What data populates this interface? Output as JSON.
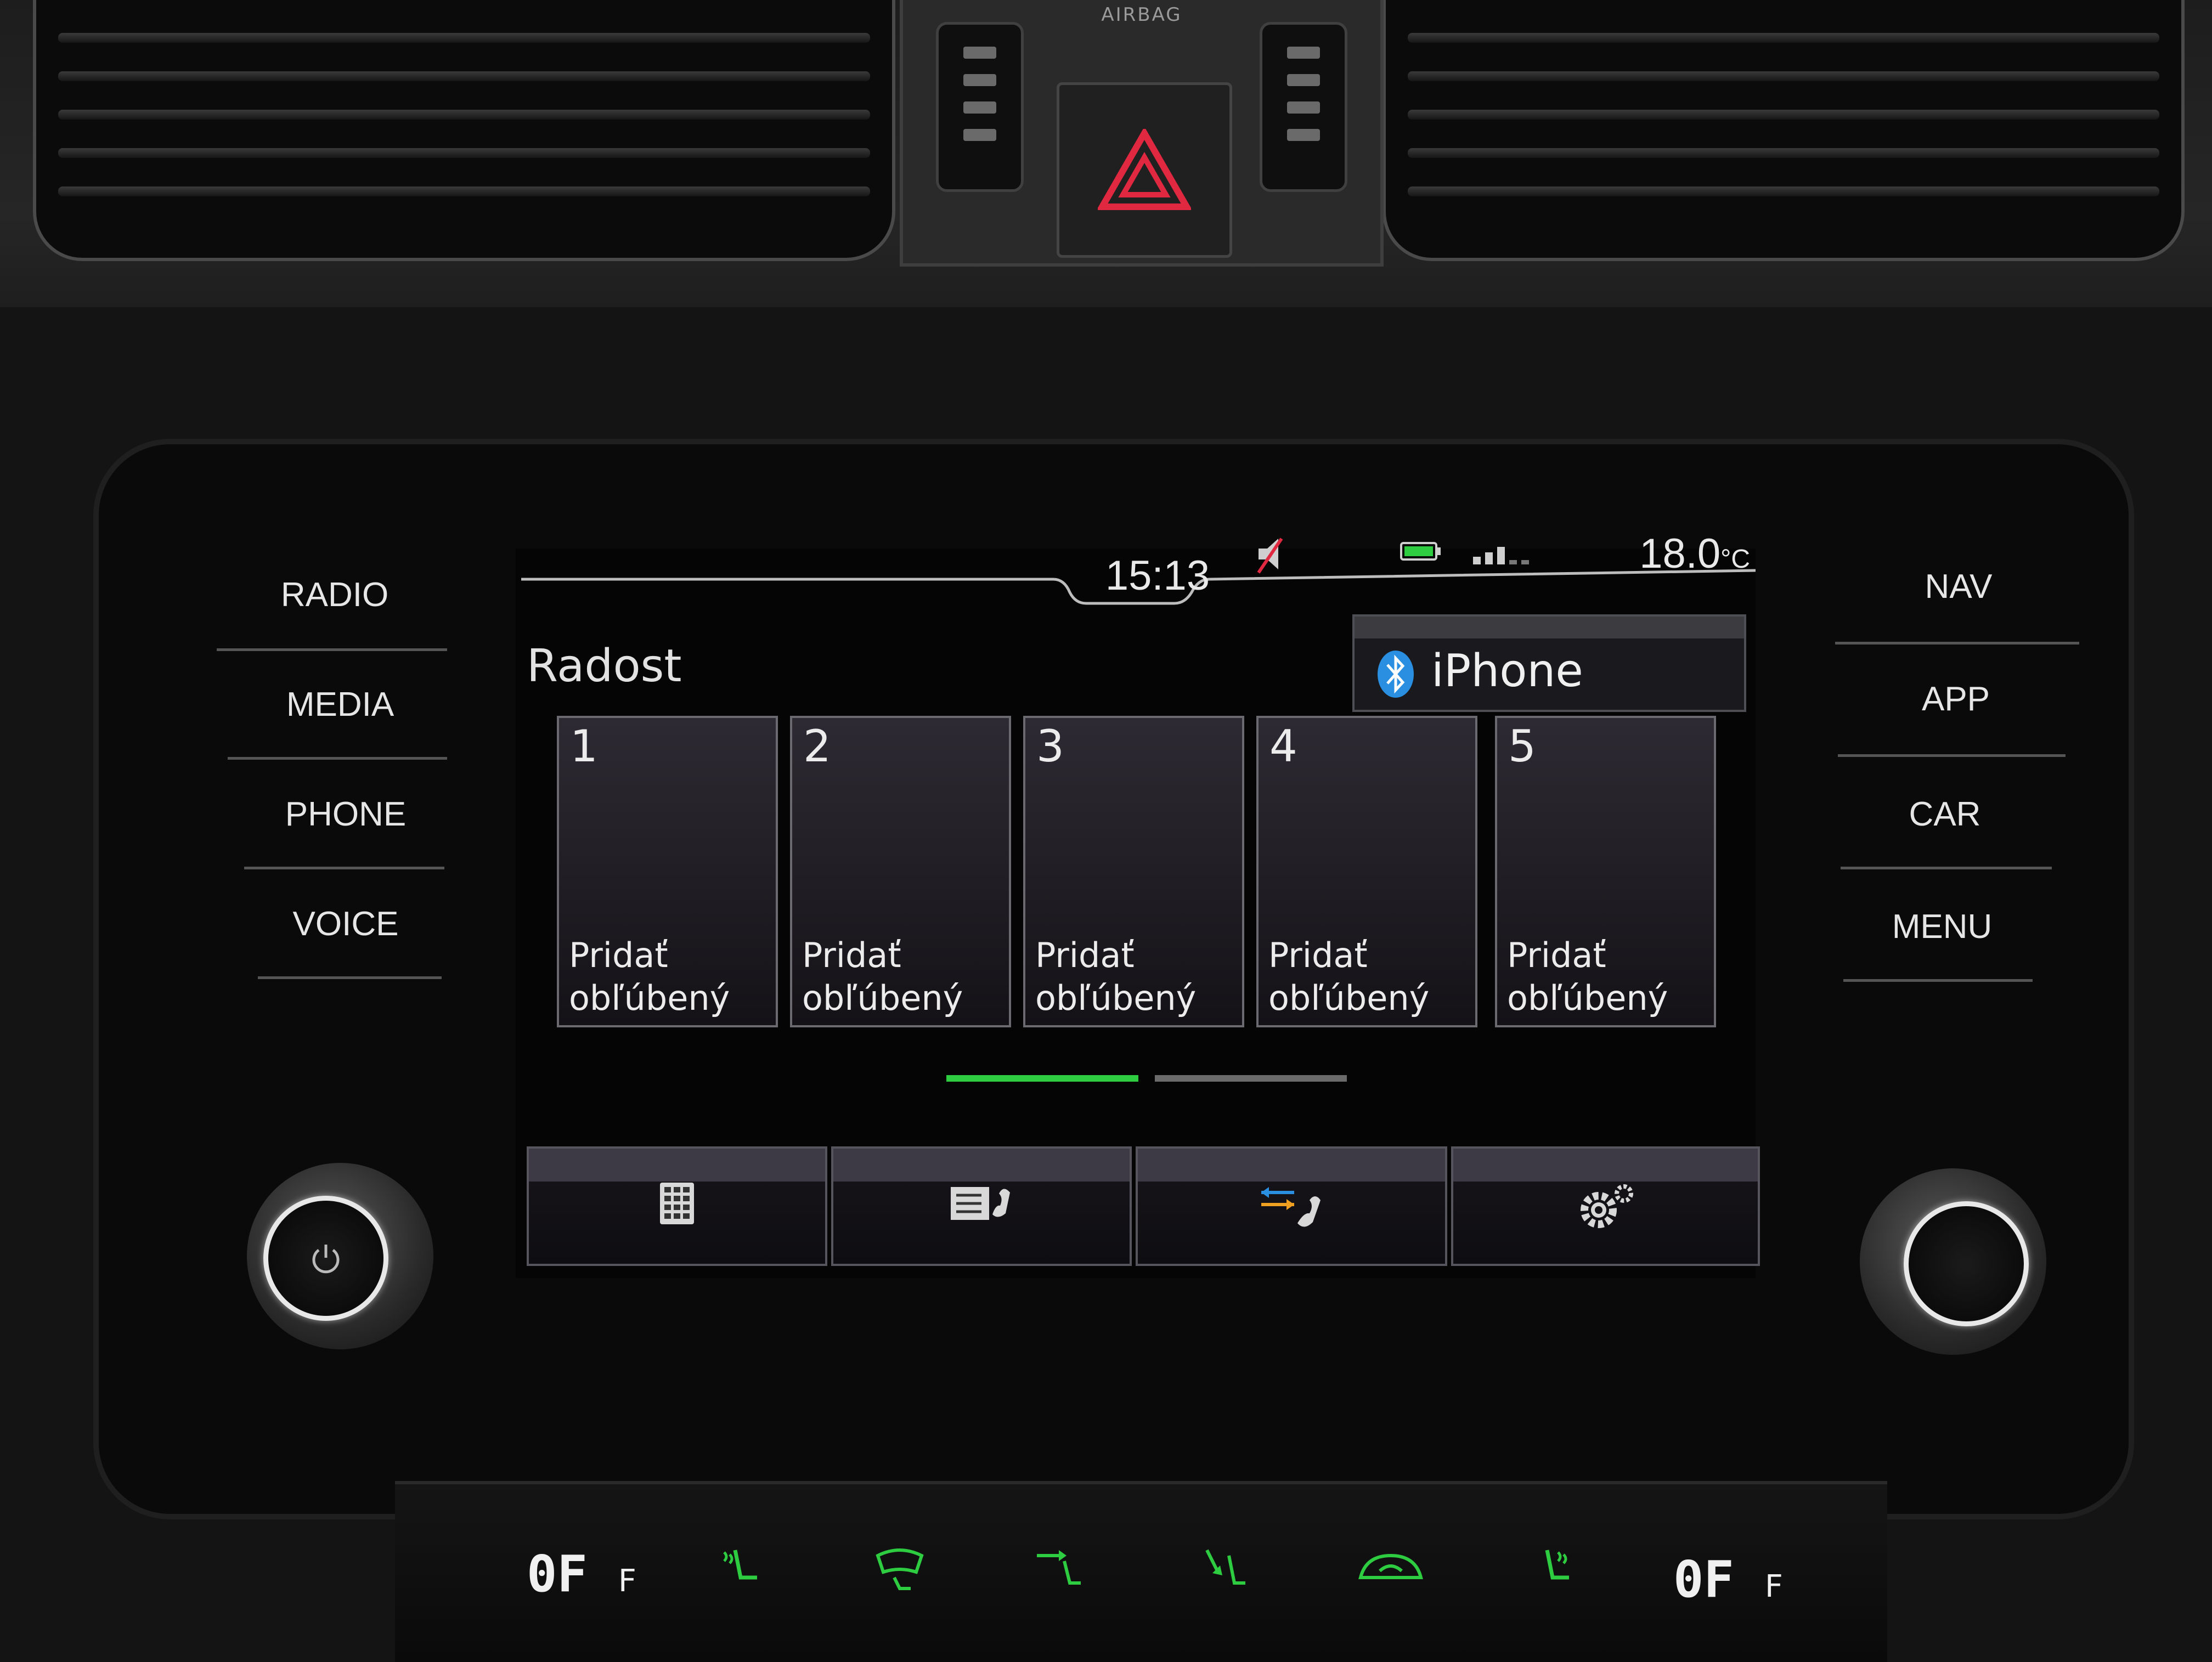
{
  "dashboard": {
    "airbag_label": "AIRBAG"
  },
  "hardware_buttons": {
    "left": [
      "RADIO",
      "MEDIA",
      "PHONE",
      "VOICE"
    ],
    "right": [
      "NAV",
      "APP",
      "CAR",
      "MENU"
    ]
  },
  "status_bar": {
    "time": "15:13",
    "temperature_value": "18.0",
    "temperature_unit": "°C",
    "icons": [
      "speaker-muted-icon",
      "battery-icon",
      "signal-strength-icon"
    ]
  },
  "phone_screen": {
    "title": "Radost",
    "connected_device": "iPhone",
    "favorites": [
      {
        "number": "1",
        "label": "Pridať\nobľúbený"
      },
      {
        "number": "2",
        "label": "Pridať\nobľúbený"
      },
      {
        "number": "3",
        "label": "Pridať\nobľúbený"
      },
      {
        "number": "4",
        "label": "Pridať\nobľúbený"
      },
      {
        "number": "5",
        "label": "Pridať\nobľúbený"
      }
    ],
    "page_indicator": {
      "pages": 2,
      "active": 1
    },
    "softkeys": [
      "keypad-icon",
      "contacts-icon",
      "call-list-icon",
      "settings-icon"
    ]
  },
  "climate": {
    "left_display": "0F",
    "left_unit": "F",
    "right_display": "0F",
    "right_unit": "F",
    "icons": [
      "seat-heat-icon",
      "rear-window-defrost-icon",
      "air-to-upper-icon",
      "air-to-feet-icon",
      "recirculation-icon",
      "seat-heat-right-icon"
    ]
  },
  "colors": {
    "accent_green": "#2ecc40",
    "ui_text": "#e9e9e9",
    "hazard_red": "#e02840",
    "bluetooth_blue": "#2a8fe0"
  }
}
